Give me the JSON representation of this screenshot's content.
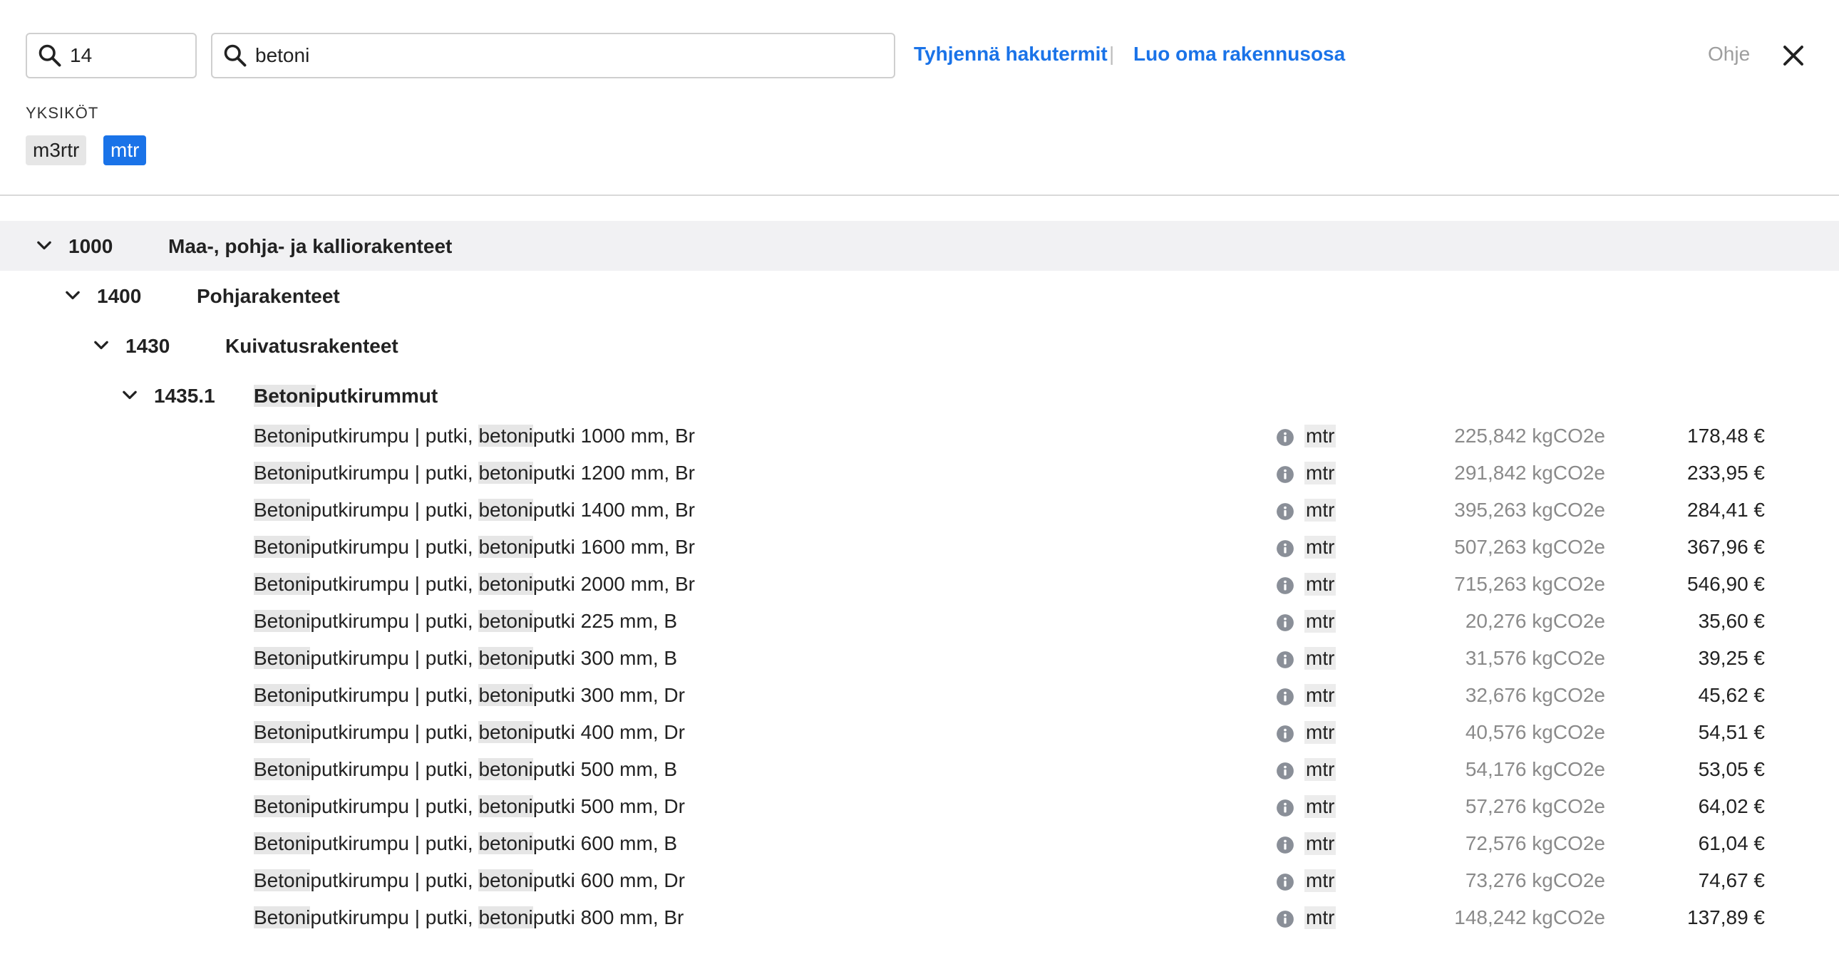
{
  "search": {
    "code_value": "14",
    "text_value": "betoni"
  },
  "actions": {
    "clear_label": "Tyhjennä hakutermit",
    "separator": "|",
    "create_label": "Luo oma rakennusosa",
    "help_label": "Ohje"
  },
  "units": {
    "heading": "YKSIKÖT",
    "chips": [
      {
        "label": "m3rtr",
        "selected": false
      },
      {
        "label": "mtr",
        "selected": true
      }
    ]
  },
  "tree": {
    "level1": {
      "code": "1000",
      "name": "Maa-, pohja- ja kalliorakenteet"
    },
    "level2": {
      "code": "1400",
      "name": "Pohjarakenteet"
    },
    "level3": {
      "code": "1430",
      "name": "Kuivatusrakenteet"
    },
    "level4": {
      "code": "1435.1",
      "name_hl": "Betoni",
      "name_rest": "putkirummut"
    }
  },
  "items": [
    {
      "hl1": "Betoni",
      "mid": "putkirumpu | putki, ",
      "hl2": "betoni",
      "rest": "putki 1000 mm, Br",
      "unit": "mtr",
      "co2": "225,842 kgCO2e",
      "price": "178,48 €"
    },
    {
      "hl1": "Betoni",
      "mid": "putkirumpu | putki, ",
      "hl2": "betoni",
      "rest": "putki 1200 mm, Br",
      "unit": "mtr",
      "co2": "291,842 kgCO2e",
      "price": "233,95 €"
    },
    {
      "hl1": "Betoni",
      "mid": "putkirumpu | putki, ",
      "hl2": "betoni",
      "rest": "putki 1400 mm, Br",
      "unit": "mtr",
      "co2": "395,263 kgCO2e",
      "price": "284,41 €"
    },
    {
      "hl1": "Betoni",
      "mid": "putkirumpu | putki, ",
      "hl2": "betoni",
      "rest": "putki 1600 mm, Br",
      "unit": "mtr",
      "co2": "507,263 kgCO2e",
      "price": "367,96 €"
    },
    {
      "hl1": "Betoni",
      "mid": "putkirumpu | putki, ",
      "hl2": "betoni",
      "rest": "putki 2000 mm, Br",
      "unit": "mtr",
      "co2": "715,263 kgCO2e",
      "price": "546,90 €"
    },
    {
      "hl1": "Betoni",
      "mid": "putkirumpu | putki, ",
      "hl2": "betoni",
      "rest": "putki 225 mm, B",
      "unit": "mtr",
      "co2": "20,276 kgCO2e",
      "price": "35,60 €"
    },
    {
      "hl1": "Betoni",
      "mid": "putkirumpu | putki, ",
      "hl2": "betoni",
      "rest": "putki 300 mm, B",
      "unit": "mtr",
      "co2": "31,576 kgCO2e",
      "price": "39,25 €"
    },
    {
      "hl1": "Betoni",
      "mid": "putkirumpu | putki, ",
      "hl2": "betoni",
      "rest": "putki 300 mm, Dr",
      "unit": "mtr",
      "co2": "32,676 kgCO2e",
      "price": "45,62 €"
    },
    {
      "hl1": "Betoni",
      "mid": "putkirumpu | putki, ",
      "hl2": "betoni",
      "rest": "putki 400 mm, Dr",
      "unit": "mtr",
      "co2": "40,576 kgCO2e",
      "price": "54,51 €"
    },
    {
      "hl1": "Betoni",
      "mid": "putkirumpu | putki, ",
      "hl2": "betoni",
      "rest": "putki 500 mm, B",
      "unit": "mtr",
      "co2": "54,176 kgCO2e",
      "price": "53,05 €"
    },
    {
      "hl1": "Betoni",
      "mid": "putkirumpu | putki, ",
      "hl2": "betoni",
      "rest": "putki 500 mm, Dr",
      "unit": "mtr",
      "co2": "57,276 kgCO2e",
      "price": "64,02 €"
    },
    {
      "hl1": "Betoni",
      "mid": "putkirumpu | putki, ",
      "hl2": "betoni",
      "rest": "putki 600 mm, B",
      "unit": "mtr",
      "co2": "72,576 kgCO2e",
      "price": "61,04 €"
    },
    {
      "hl1": "Betoni",
      "mid": "putkirumpu | putki, ",
      "hl2": "betoni",
      "rest": "putki 600 mm, Dr",
      "unit": "mtr",
      "co2": "73,276 kgCO2e",
      "price": "74,67 €"
    },
    {
      "hl1": "Betoni",
      "mid": "putkirumpu | putki, ",
      "hl2": "betoni",
      "rest": "putki 800 mm, Br",
      "unit": "mtr",
      "co2": "148,242 kgCO2e",
      "price": "137,89 €"
    }
  ],
  "colors": {
    "accent": "#1a73e8",
    "highlight": "#e6e6e6",
    "muted": "#8a8a8a"
  }
}
